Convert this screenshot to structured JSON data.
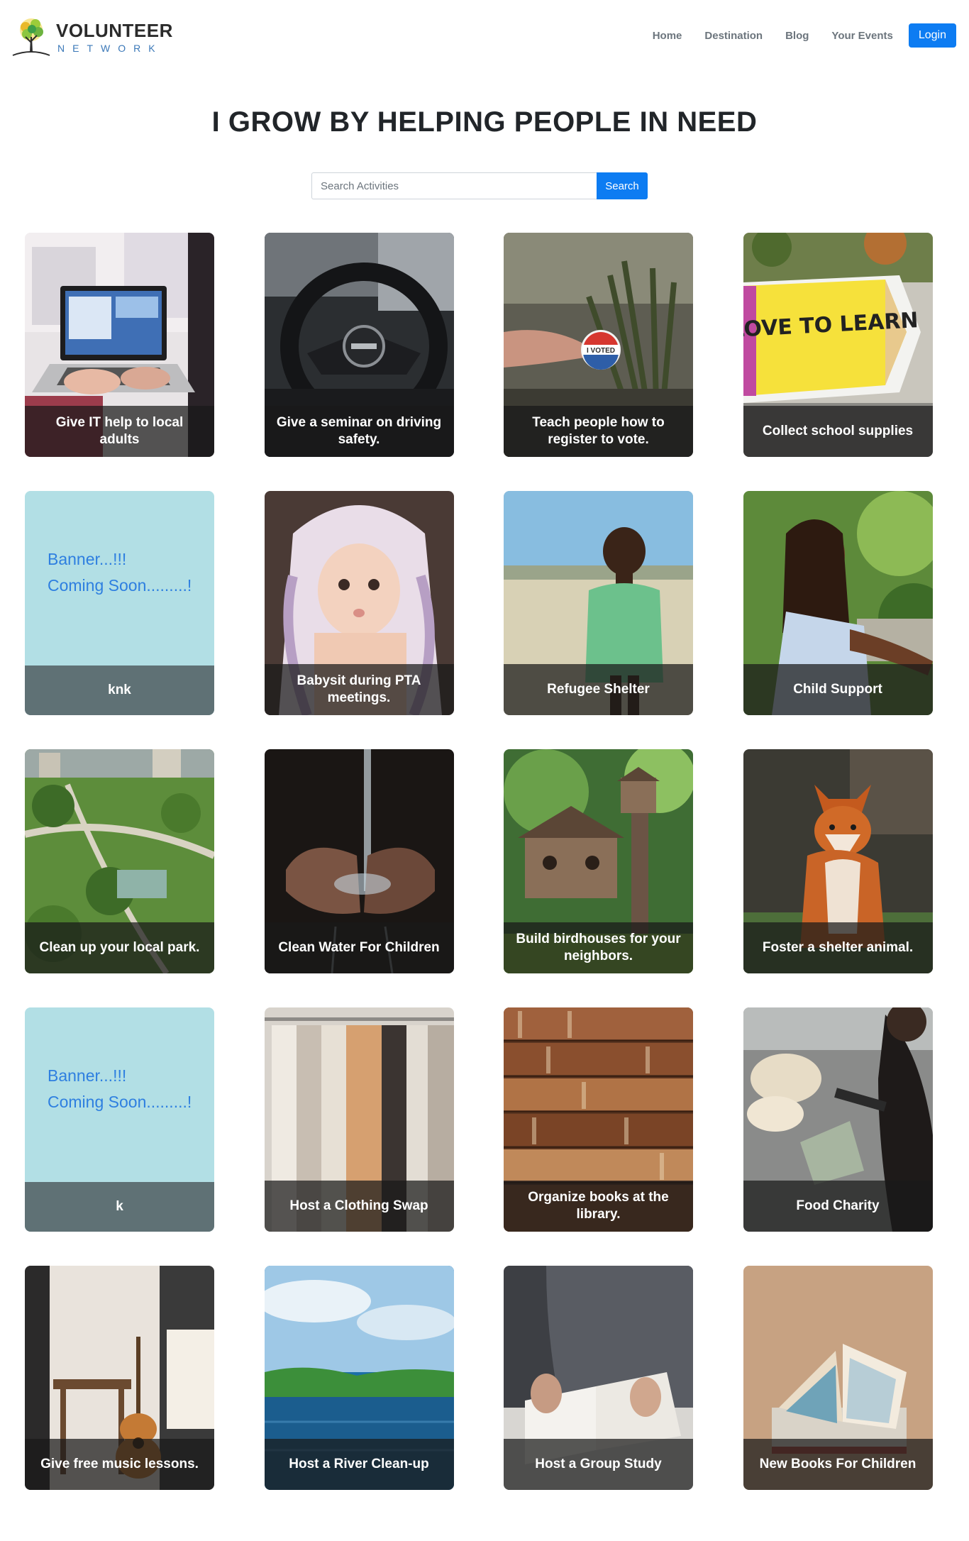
{
  "brand": {
    "name": "VOLUNTEER",
    "tagline": "NETWORK",
    "colors": {
      "primary": "#0d7cf2",
      "logo_text": "#3b78b8"
    }
  },
  "nav": {
    "items": [
      {
        "label": "Home"
      },
      {
        "label": "Destination"
      },
      {
        "label": "Blog"
      },
      {
        "label": "Your Events"
      }
    ],
    "login_label": "Login"
  },
  "hero": {
    "title": "I GROW BY HELPING PEOPLE IN NEED"
  },
  "search": {
    "placeholder": "Search Activities",
    "value": "",
    "button_label": "Search"
  },
  "cards": [
    {
      "title": "Give IT help to local adults",
      "icon": "laptop-photo",
      "art": "laptop"
    },
    {
      "title": "Give a seminar on driving safety.",
      "icon": "steering-wheel-photo",
      "art": "car"
    },
    {
      "title": "Teach people how to register to vote.",
      "icon": "i-voted-sticker-photo",
      "art": "vote",
      "sticker_text": "I VOTED"
    },
    {
      "title": "Collect school supplies",
      "icon": "pencil-sign-photo",
      "art": "pencil",
      "sign_text": "LOVE TO LEARN"
    },
    {
      "title": "knk",
      "icon": "banner-placeholder",
      "art": "banner",
      "banner_line1": "Banner...!!!",
      "banner_line2": "Coming Soon.........!"
    },
    {
      "title": "Babysit during PTA meetings.",
      "icon": "baby-photo",
      "art": "baby"
    },
    {
      "title": "Refugee Shelter",
      "icon": "child-field-photo",
      "art": "refugee"
    },
    {
      "title": "Child Support",
      "icon": "girl-smiling-photo",
      "art": "girl"
    },
    {
      "title": "Clean up your local park.",
      "icon": "park-aerial-photo",
      "art": "park"
    },
    {
      "title": "Clean Water For Children",
      "icon": "water-hands-photo",
      "art": "water"
    },
    {
      "title": "Build birdhouses for your neighbors.",
      "icon": "birdhouse-photo",
      "art": "birdhouse"
    },
    {
      "title": "Foster a shelter animal.",
      "icon": "fox-photo",
      "art": "fox"
    },
    {
      "title": "k",
      "icon": "banner-placeholder",
      "art": "banner",
      "banner_line1": "Banner...!!!",
      "banner_line2": "Coming Soon.........!"
    },
    {
      "title": "Host a Clothing Swap",
      "icon": "clothes-rack-photo",
      "art": "clothes"
    },
    {
      "title": "Organize books at the library.",
      "icon": "bookshelf-photo",
      "art": "library"
    },
    {
      "title": "Food Charity",
      "icon": "food-donation-photo",
      "art": "food"
    },
    {
      "title": "Give free music lessons.",
      "icon": "guitar-photo",
      "art": "guitar"
    },
    {
      "title": "Host a River Clean-up",
      "icon": "river-photo",
      "art": "river"
    },
    {
      "title": "Host a Group Study",
      "icon": "study-book-photo",
      "art": "study"
    },
    {
      "title": "New Books For Children",
      "icon": "open-book-photo",
      "art": "books"
    }
  ]
}
